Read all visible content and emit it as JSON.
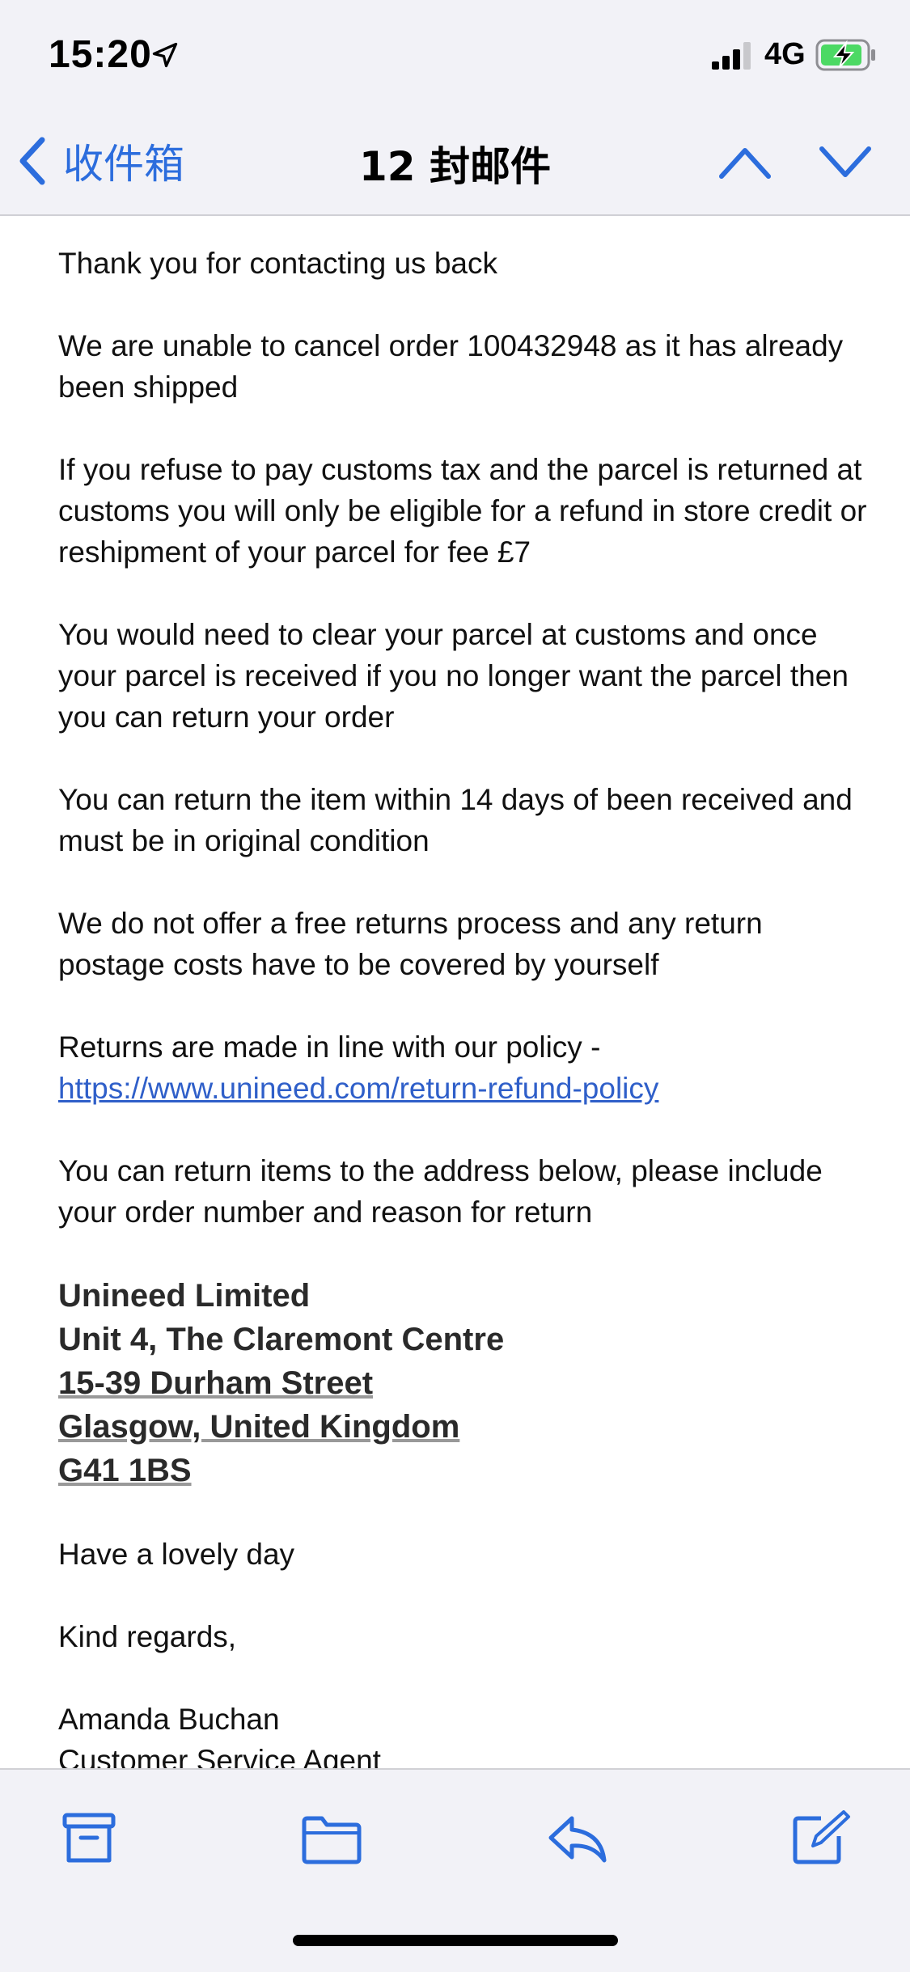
{
  "status": {
    "time": "15:20",
    "network": "4G"
  },
  "nav": {
    "back_label": "收件箱",
    "title": "12 封邮件"
  },
  "email": {
    "paragraphs": [
      "Thank you for contacting us back",
      "We are unable to cancel order 100432948 as it has already been shipped",
      "If you refuse to pay customs tax and the parcel is returned at customs you will only be eligible for a refund in store credit or reshipment of your parcel for fee £7",
      "You would need to clear your parcel at customs and once your parcel is received if you no longer want the parcel then you can return your order",
      "You can return the item within 14 days of been received and must be in original condition",
      "We do not offer a free returns process and any return postage costs have to be covered by yourself"
    ],
    "policy_text": "Returns are made in line with our policy - ",
    "policy_link": "https://www.unineed.com/return-refund-policy",
    "return_instructions": "You can return items to the address below, please include your order number and reason for return",
    "address": {
      "line1": "Unineed Limited",
      "line2": "Unit 4, The Claremont Centre",
      "line3": "15-39 Durham Street",
      "line4": "Glasgow, United Kingdom",
      "line5": "G41 1BS"
    },
    "closing": "Have a lovely day",
    "regards": "Kind regards,",
    "signature_name": "Amanda Buchan",
    "signature_title": "Customer Service Agent"
  },
  "colors": {
    "accent": "#2c6ddd",
    "link": "#2f5fc9",
    "bar_bg": "#f2f2f7",
    "battery_green": "#4cd964"
  },
  "toolbar": {
    "icons": [
      "archive-icon",
      "folder-icon",
      "reply-icon",
      "compose-icon"
    ]
  }
}
